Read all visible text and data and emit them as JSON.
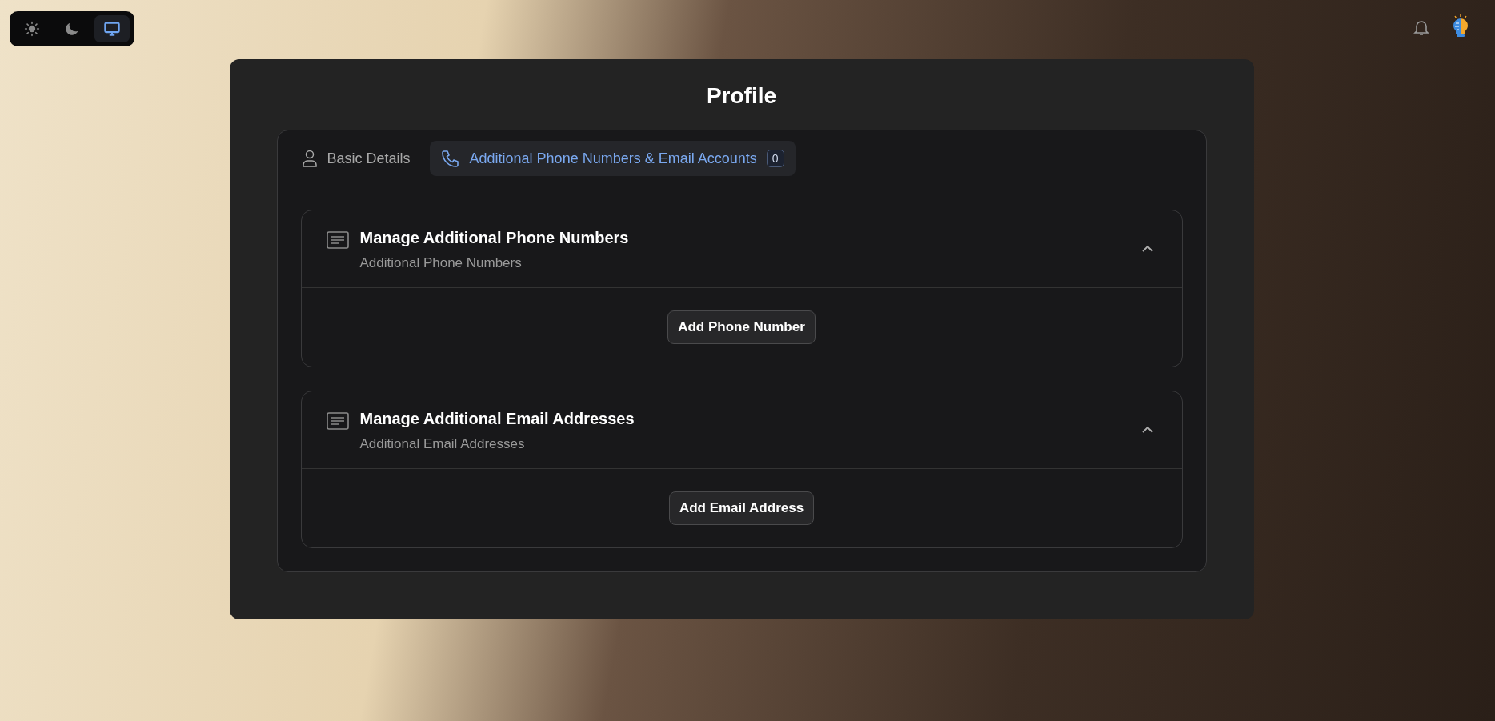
{
  "theme_switcher": [
    {
      "kind": "light",
      "selected": false
    },
    {
      "kind": "dark",
      "selected": false
    },
    {
      "kind": "system",
      "selected": true
    }
  ],
  "profile": {
    "title": "Profile",
    "tabs": [
      {
        "kind": "person",
        "label": "Basic Details",
        "selected": false
      },
      {
        "kind": "phone",
        "label": "Additional Phone Numbers & Email Accounts",
        "selected": true,
        "badge": "0"
      }
    ],
    "sections": [
      {
        "title": "Manage Additional Phone Numbers",
        "subtitle": "Additional Phone Numbers",
        "expanded": true,
        "button": "Add Phone Number"
      },
      {
        "title": "Manage Additional Email Addresses",
        "subtitle": "Additional Email Addresses",
        "expanded": true,
        "button": "Add Email Address"
      }
    ]
  }
}
